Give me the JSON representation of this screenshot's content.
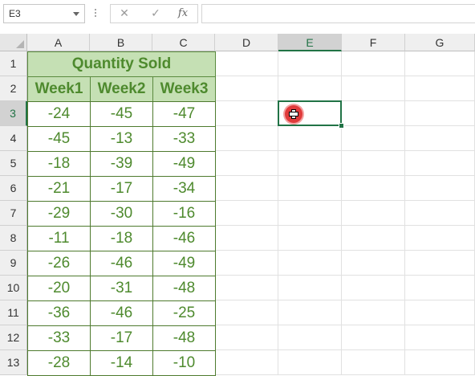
{
  "formula_bar": {
    "name_box": "E3",
    "cancel_icon": "✕",
    "enter_icon": "✓",
    "fx_label": "fx",
    "formula": ""
  },
  "columns": [
    "A",
    "B",
    "C",
    "D",
    "E",
    "F",
    "G"
  ],
  "rows": [
    "1",
    "2",
    "3",
    "4",
    "5",
    "6",
    "7",
    "8",
    "9",
    "10",
    "11",
    "12",
    "13"
  ],
  "selected_cell": "E3",
  "table": {
    "title": "Quantity Sold",
    "headers": [
      "Week1",
      "Week2",
      "Week3"
    ],
    "rows": [
      [
        "-24",
        "-45",
        "-47"
      ],
      [
        "-45",
        "-13",
        "-33"
      ],
      [
        "-18",
        "-39",
        "-49"
      ],
      [
        "-21",
        "-17",
        "-34"
      ],
      [
        "-29",
        "-30",
        "-16"
      ],
      [
        "-11",
        "-18",
        "-46"
      ],
      [
        "-26",
        "-46",
        "-49"
      ],
      [
        "-20",
        "-31",
        "-48"
      ],
      [
        "-36",
        "-46",
        "-25"
      ],
      [
        "-33",
        "-17",
        "-48"
      ],
      [
        "-28",
        "-14",
        "-10"
      ]
    ]
  },
  "colors": {
    "header_fill": "#c5e0b4",
    "text_green": "#4e8a2e",
    "selection": "#217346",
    "cursor": "#e03b3b"
  }
}
